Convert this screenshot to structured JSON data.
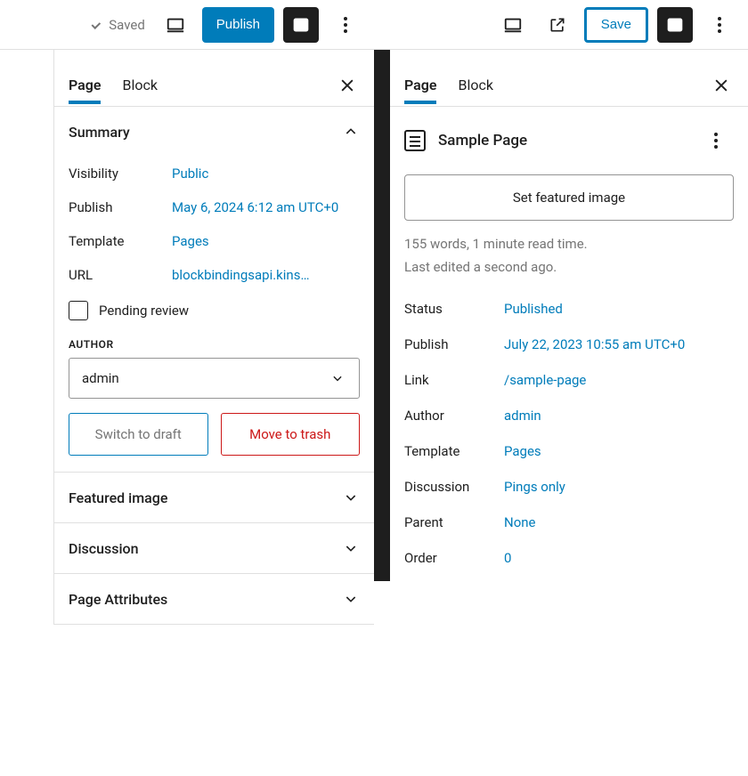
{
  "left": {
    "toolbar": {
      "saved_label": "Saved",
      "publish_label": "Publish"
    },
    "tabs": {
      "page": "Page",
      "block": "Block"
    },
    "summary": {
      "heading": "Summary",
      "visibility_label": "Visibility",
      "visibility_value": "Public",
      "publish_label": "Publish",
      "publish_value": "May 6, 2024 6:12 am UTC+0",
      "template_label": "Template",
      "template_value": "Pages",
      "url_label": "URL",
      "url_value": "blockbindingsapi.kins…",
      "pending_label": "Pending review",
      "author_heading": "AUTHOR",
      "author_value": "admin",
      "switch_draft": "Switch to draft",
      "move_trash": "Move to trash"
    },
    "panels": {
      "featured_image": "Featured image",
      "discussion": "Discussion",
      "page_attributes": "Page Attributes"
    }
  },
  "right": {
    "toolbar": {
      "save_label": "Save"
    },
    "tabs": {
      "page": "Page",
      "block": "Block"
    },
    "card": {
      "title": "Sample Page",
      "featured_btn": "Set featured image",
      "meta_line1": "155 words, 1 minute read time.",
      "meta_line2": "Last edited a second ago."
    },
    "props": {
      "status_label": "Status",
      "status_value": "Published",
      "publish_label": "Publish",
      "publish_value": "July 22, 2023 10:55 am UTC+0",
      "link_label": "Link",
      "link_value": "/sample-page",
      "author_label": "Author",
      "author_value": "admin",
      "template_label": "Template",
      "template_value": "Pages",
      "discussion_label": "Discussion",
      "discussion_value": "Pings only",
      "parent_label": "Parent",
      "parent_value": "None",
      "order_label": "Order",
      "order_value": "0"
    }
  }
}
